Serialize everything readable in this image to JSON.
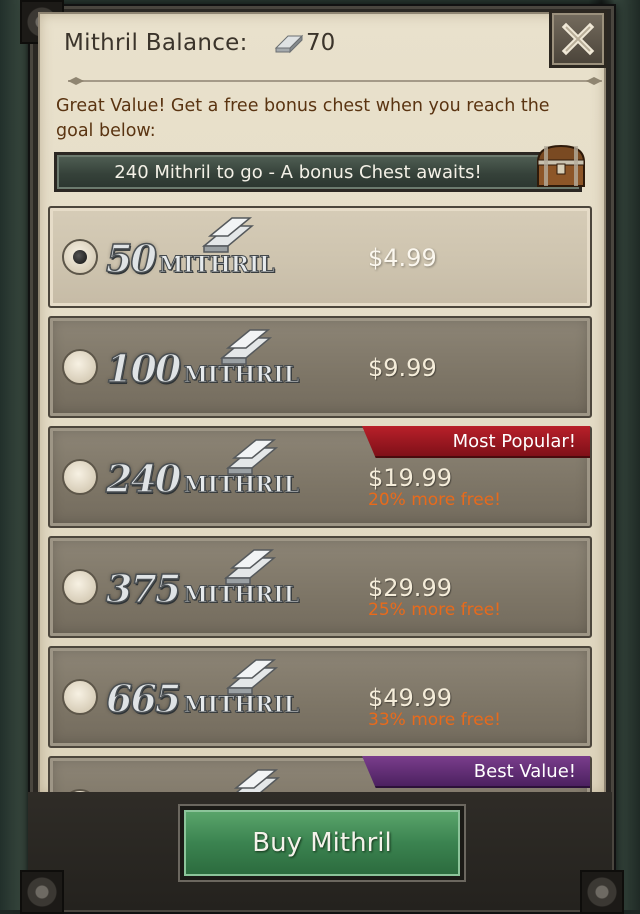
{
  "header": {
    "balance_label": "Mithril Balance:",
    "balance_value": "70",
    "close_icon": "close-x-icon"
  },
  "promo": {
    "text": "Great Value! Get a free bonus chest when you reach the goal below:",
    "goal_text": "240 Mithril to go - A bonus Chest awaits!",
    "chest_icon": "treasure-chest-icon"
  },
  "offers": [
    {
      "quantity": "50",
      "unit": "MITHRIL",
      "price": "$4.99",
      "bonus": "",
      "ribbon": "",
      "selected": true
    },
    {
      "quantity": "100",
      "unit": "MITHRIL",
      "price": "$9.99",
      "bonus": "",
      "ribbon": "",
      "selected": false
    },
    {
      "quantity": "240",
      "unit": "MITHRIL",
      "price": "$19.99",
      "bonus": "20% more free!",
      "ribbon": "Most Popular!",
      "selected": false
    },
    {
      "quantity": "375",
      "unit": "MITHRIL",
      "price": "$29.99",
      "bonus": "25% more free!",
      "ribbon": "",
      "selected": false
    },
    {
      "quantity": "665",
      "unit": "MITHRIL",
      "price": "$49.99",
      "bonus": "33% more free!",
      "ribbon": "",
      "selected": false
    },
    {
      "quantity": "",
      "unit": "",
      "price": "",
      "bonus": "",
      "ribbon": "Best Value!",
      "selected": false
    }
  ],
  "buy_button": {
    "label": "Buy Mithril"
  },
  "colors": {
    "accent_orange": "#e86a1b",
    "ribbon_red": "#b8202a",
    "ribbon_purple": "#7a3d8c",
    "buy_green": "#3b8350"
  }
}
